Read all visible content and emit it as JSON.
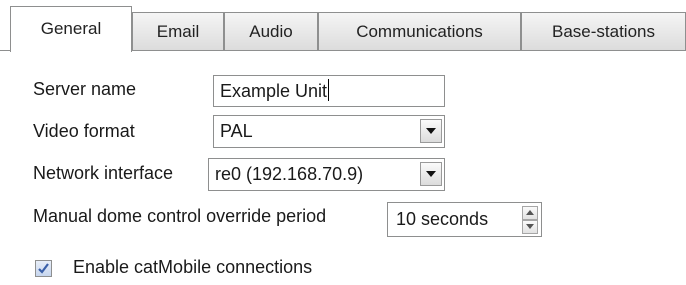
{
  "tabs": [
    {
      "label": "General",
      "active": true
    },
    {
      "label": "Email",
      "active": false
    },
    {
      "label": "Audio",
      "active": false
    },
    {
      "label": "Communications",
      "active": false
    },
    {
      "label": "Base-stations",
      "active": false
    }
  ],
  "form": {
    "server_name": {
      "label": "Server name",
      "value": "Example Unit"
    },
    "video_format": {
      "label": "Video format",
      "value": "PAL"
    },
    "network_interface": {
      "label": "Network interface",
      "value": "re0 (192.168.70.9)"
    },
    "dome_override": {
      "label": "Manual dome control override period",
      "value": "10 seconds"
    },
    "catmobile": {
      "label": "Enable catMobile connections",
      "checked": true
    }
  },
  "icons": {
    "dropdown": "chevron-down-icon",
    "spin_up": "arrow-up-icon",
    "spin_down": "arrow-down-icon",
    "checkmark": "checkmark-icon"
  },
  "colors": {
    "border": "#8e8f8f",
    "check": "#3a5fa8"
  }
}
